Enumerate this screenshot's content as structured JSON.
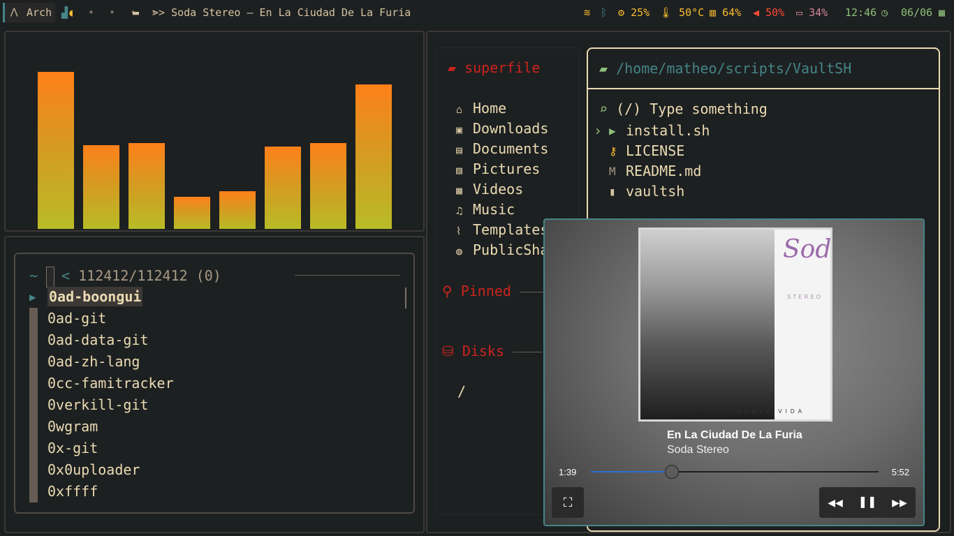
{
  "topbar": {
    "workspace_icon": "arch-logo-icon",
    "workspace_label": "Arch",
    "dots": "• • • •",
    "window_title": ">> Soda Stereo – En La Ciudad De La Furia",
    "cpu": "25%",
    "temp": "50°C",
    "memory": "64%",
    "volume": "50%",
    "battery": "34%",
    "time": "12:46",
    "date": "06/06"
  },
  "fzf": {
    "prompt_symbol": "~",
    "prompt_chevron": "<",
    "count": "112412/112412 (0)",
    "items": [
      "0ad-boongui",
      "0ad-git",
      "0ad-data-git",
      "0ad-zh-lang",
      "0cc-famitracker",
      "0verkill-git",
      "0wgram",
      "0x-git",
      "0x0uploader",
      "0xffff"
    ]
  },
  "superfile": {
    "title": "superfile",
    "sidebar": [
      {
        "icon": "home-icon",
        "glyph": "⌂",
        "label": "Home"
      },
      {
        "icon": "download-icon",
        "glyph": "▣",
        "label": "Downloads"
      },
      {
        "icon": "document-icon",
        "glyph": "▤",
        "label": "Documents"
      },
      {
        "icon": "picture-icon",
        "glyph": "▨",
        "label": "Pictures"
      },
      {
        "icon": "video-icon",
        "glyph": "▦",
        "label": "Videos"
      },
      {
        "icon": "music-icon",
        "glyph": "♫",
        "label": "Music"
      },
      {
        "icon": "paperclip-icon",
        "glyph": "⌇",
        "label": "Templates"
      },
      {
        "icon": "globe-icon",
        "glyph": "◍",
        "label": "PublicShare"
      }
    ],
    "pinned_label": "Pinned",
    "disks_label": "Disks",
    "disk_root": "/",
    "path": "/home/matheo/scripts/VaultSH",
    "search_placeholder": "(/) Type something",
    "files": [
      {
        "icon": "terminal-icon",
        "glyph": "▶",
        "label": "install.sh"
      },
      {
        "icon": "key-icon",
        "glyph": "⚷",
        "label": "LICENSE"
      },
      {
        "icon": "markdown-icon",
        "glyph": "M",
        "label": "README.md"
      },
      {
        "icon": "file-icon",
        "glyph": "▮",
        "label": "vaultsh"
      }
    ]
  },
  "visualizer": {
    "levels": [
      0.88,
      0.47,
      0.48,
      0.18,
      0.21,
      0.46,
      0.48,
      0.81
    ]
  },
  "media": {
    "song": "En La Ciudad De La Furia",
    "artist": "Soda Stereo",
    "current_time": "1:39",
    "total_time": "5:52",
    "progress": 0.28,
    "cover_brand": "Soda",
    "cover_sub": "STEREO",
    "cover_foot": "DOBLE VIDA"
  }
}
